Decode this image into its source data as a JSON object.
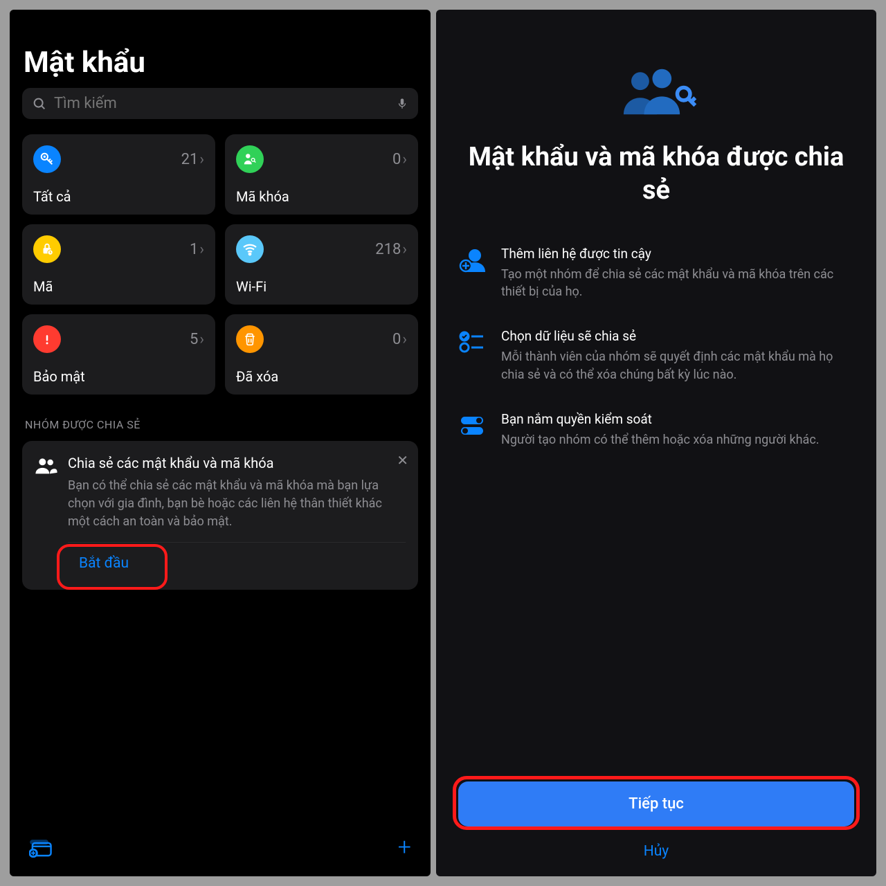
{
  "left": {
    "title": "Mật khẩu",
    "search_placeholder": "Tìm kiếm",
    "tiles": [
      {
        "label": "Tất cả",
        "count": "21"
      },
      {
        "label": "Mã khóa",
        "count": "0"
      },
      {
        "label": "Mã",
        "count": "1"
      },
      {
        "label": "Wi-Fi",
        "count": "218"
      },
      {
        "label": "Bảo mật",
        "count": "5"
      },
      {
        "label": "Đã xóa",
        "count": "0"
      }
    ],
    "section_header": "NHÓM ĐƯỢC CHIA SẺ",
    "share_card": {
      "title": "Chia sẻ các mật khẩu và mã khóa",
      "desc": "Bạn có thể chia sẻ các mật khẩu và mã khóa mà bạn lựa chọn với gia đình, bạn bè hoặc các liên hệ thân thiết khác một cách an toàn và bảo mật.",
      "start": "Bắt đầu"
    }
  },
  "right": {
    "hero_title": "Mật khẩu và mã khóa được chia sẻ",
    "features": [
      {
        "title": "Thêm liên hệ được tin cậy",
        "desc": "Tạo một nhóm để chia sẻ các mật khẩu và mã khóa trên các thiết bị của họ."
      },
      {
        "title": "Chọn dữ liệu sẽ chia sẻ",
        "desc": "Mỗi thành viên của nhóm sẽ quyết định các mật khẩu mà họ chia sẻ và có thể xóa chúng bất kỳ lúc nào."
      },
      {
        "title": "Bạn nắm quyền kiểm soát",
        "desc": "Người tạo nhóm có thể thêm hoặc xóa những người khác."
      }
    ],
    "continue": "Tiếp tục",
    "cancel": "Hủy"
  }
}
